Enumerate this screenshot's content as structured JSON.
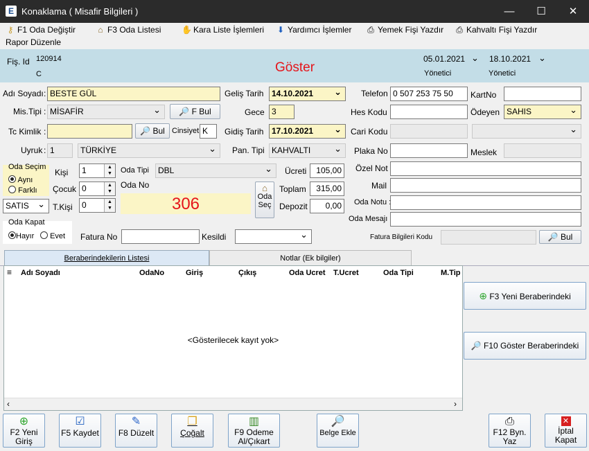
{
  "window": {
    "title": "Konaklama ( Misafir Bilgileri )",
    "app_icon": "E",
    "minimize": "—",
    "maximize": "☐",
    "close": "✕"
  },
  "menu": [
    {
      "label": "F1 Oda Değiştir",
      "icon": "key-icon"
    },
    {
      "label": "F3 Oda Listesi",
      "icon": "house-icon"
    },
    {
      "label": "Kara Liste İşlemleri",
      "icon": "hand-icon"
    },
    {
      "label": "Yardımcı İşlemler",
      "icon": "down-arrow-icon"
    },
    {
      "label": "Yemek Fişi Yazdır",
      "icon": "printer-icon"
    },
    {
      "label": "Kahvaltı Fişi Yazdır",
      "icon": "printer-icon"
    },
    {
      "label": "Rapor Düzenle"
    }
  ],
  "header": {
    "fis_label": "Fiş. Id",
    "fis_id": "120914",
    "fis_sub": "C",
    "goster": "Göster",
    "date1": "05.01.2021",
    "user1": "Yönetici",
    "date2": "18.10.2021",
    "user2": "Yönetici"
  },
  "form": {
    "adsoyad_label": "Adı Soyadı",
    "adsoyad": "BESTE GÜL",
    "mistipi_label": "Mis.Tipi",
    "mistipi": "MİSAFİR",
    "fbul": "F Bul",
    "tckimlik_label": "Tc Kimlik",
    "bul": "Bul",
    "cinsiyet_label": "Cinsiyet",
    "cinsiyet": "K",
    "uyruk_label": "Uyruk",
    "uyruk_code": "1",
    "uyruk": "TÜRKİYE",
    "gelis_label": "Geliş Tarih",
    "gelis": "14.10.2021",
    "gece_label": "Gece",
    "gece": "3",
    "gidis_label": "Gidiş Tarih",
    "gidis": "17.10.2021",
    "pantipi_label": "Pan. Tipi",
    "pantipi": "KAHVALTI",
    "telefon_label": "Telefon",
    "telefon": "0 507 253 75 50",
    "kartno_label": "KartNo",
    "kartno": "",
    "heskodu_label": "Hes Kodu",
    "heskodu": "",
    "odeyen_label": "Ödeyen",
    "odeyen": "SAHIS",
    "carikodu_label": "Cari Kodu",
    "plakano_label": "Plaka No",
    "meslek_label": "Meslek",
    "ozelnot_label": "Özel Not",
    "mail_label": "Mail",
    "odanotu_label": "Oda Notu :",
    "odamesaji_label": "Oda Mesajı :",
    "oda_secim_label": "Oda Seçim",
    "ayni": "Aynı",
    "farkli": "Farklı",
    "satis": "SATIS",
    "kisi_label": "Kişi",
    "kisi": "1",
    "cocuk_label": "Çocuk",
    "cocuk": "0",
    "tkisi_label": "T.Kişi",
    "tkisi": "0",
    "odatipi_label": "Oda Tipi",
    "odatipi": "DBL",
    "odano_label": "Oda No",
    "odano": "306",
    "odasec": "Oda Seç",
    "ucret_label": "Ücreti",
    "ucret": "105,00",
    "toplam_label": "Toplam",
    "toplam": "315,00",
    "depozit_label": "Depozit",
    "depozit": "0,00",
    "oda_kapat_label": "Oda Kapat",
    "hayir": "Hayır",
    "evet": "Evet",
    "faturano_label": "Fatura No",
    "kesildi_label": "Kesildi",
    "fatura_bilgi_label": "Fatura Bilgileri Kodu",
    "fatura_bul": "Bul"
  },
  "tabs": [
    {
      "label": "Beraberindekilerin Listesi"
    },
    {
      "label": "Notlar (Ek bilgiler)"
    }
  ],
  "grid": {
    "columns": [
      "Adı Soyadı",
      "OdaNo",
      "Giriş",
      "Çıkış",
      "Oda Ucret",
      "T.Ucret",
      "Oda Tipi",
      "M.Tip"
    ],
    "empty": "<Gösterilecek kayıt yok>"
  },
  "side_buttons": [
    {
      "label": "F3 Yeni Beraberindeki"
    },
    {
      "label": "F10 Göster  Beraberindeki"
    }
  ],
  "footer": [
    {
      "label1": "F2 Yeni",
      "label2": "Giriş",
      "icon": "plus-icon"
    },
    {
      "label1": "F5 Kaydet",
      "label2": "",
      "icon": "check-icon"
    },
    {
      "label1": "F8 Düzelt",
      "label2": "",
      "icon": "pencil-icon"
    },
    {
      "label1": "Çoğalt",
      "label2": "",
      "icon": "copy-icon"
    },
    {
      "label1": "F9 Odeme",
      "label2": "Al/Çıkart",
      "icon": "money-icon"
    },
    {
      "label1": "Belge Ekle",
      "label2": "",
      "icon": "search-icon"
    },
    {
      "label1": "F12 Byn.",
      "label2": "Yaz",
      "icon": "printer-icon"
    },
    {
      "label1": "İptal",
      "label2": "Kapat",
      "icon": "cancel-icon"
    }
  ],
  "colors": {
    "header_bg": "#c3dde7",
    "goster": "#e5151b",
    "odano": "#e5151b",
    "titlebar": "#2b2b2b"
  }
}
